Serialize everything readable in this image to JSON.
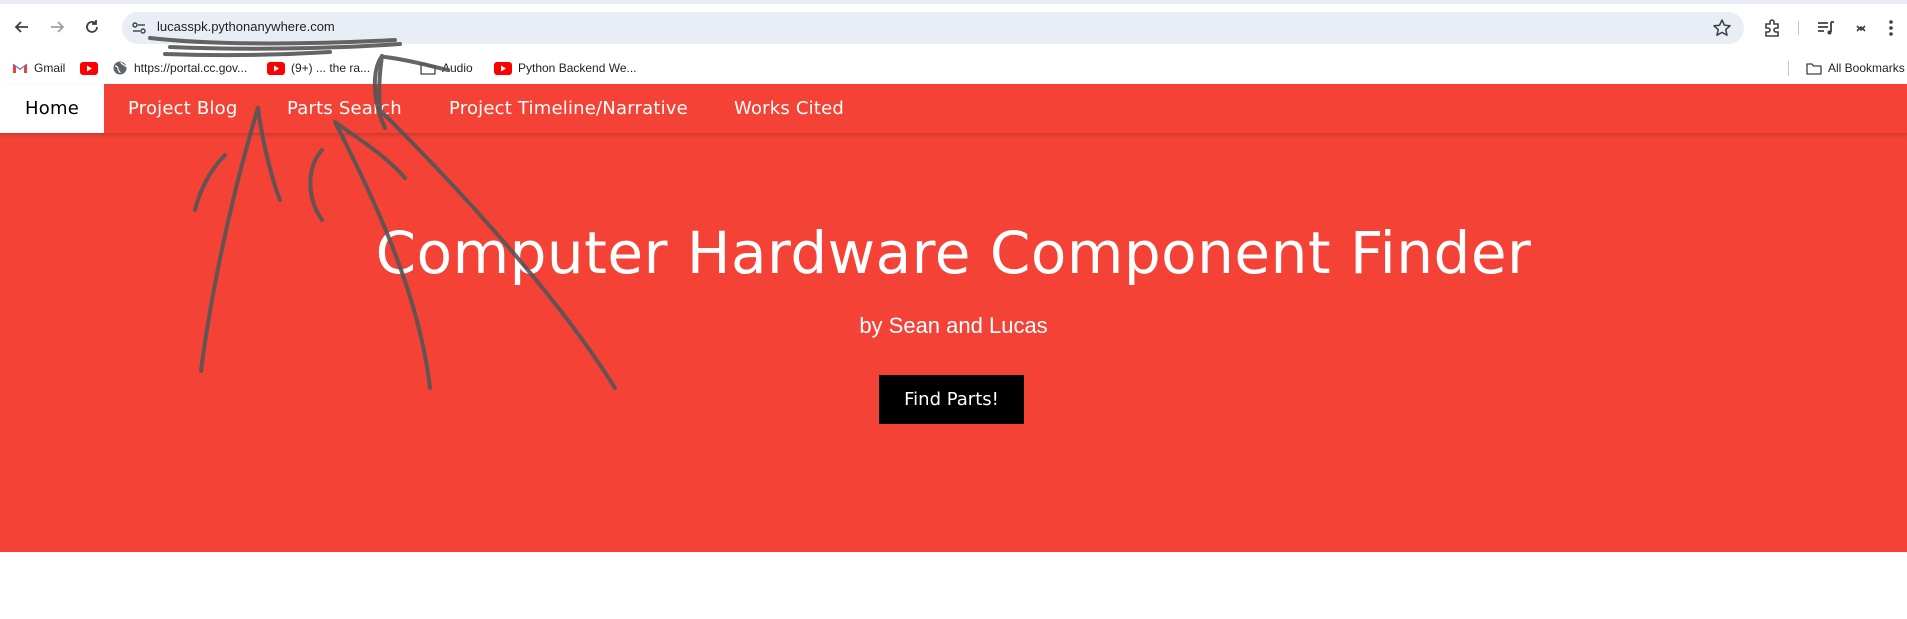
{
  "browser": {
    "url": "lucasspk.pythonanywhere.com",
    "nav": {
      "back_icon": "arrow-left-icon",
      "forward_icon": "arrow-right-icon",
      "reload_icon": "reload-icon"
    },
    "toolbar_icons": [
      "star-icon",
      "extensions-icon",
      "reading-list-icon",
      "account-icon",
      "more-vert-icon"
    ]
  },
  "bookmarks": {
    "items": [
      {
        "label": "Gmail",
        "icon": "gmail-icon"
      },
      {
        "label": "",
        "icon": "youtube-icon"
      },
      {
        "label": "https://portal.cc.gov...",
        "icon": "globe-icon"
      },
      {
        "label": "(9+) ... the ra...",
        "icon": "youtube-icon"
      },
      {
        "label": "Audio",
        "icon": "folder-icon"
      },
      {
        "label": "Python Backend We...",
        "icon": "youtube-icon"
      }
    ],
    "all_bookmarks": "All Bookmarks"
  },
  "site": {
    "nav": {
      "items": [
        {
          "label": "Home",
          "active": true
        },
        {
          "label": "Project Blog",
          "active": false
        },
        {
          "label": "Parts Search",
          "active": false
        },
        {
          "label": "Project Timeline/Narrative",
          "active": false
        },
        {
          "label": "Works Cited",
          "active": false
        }
      ]
    },
    "hero": {
      "title": "Computer Hardware Component Finder",
      "subtitle": "by Sean and Lucas",
      "button": "Find Parts!"
    }
  },
  "colors": {
    "brand_red": "#f44336",
    "button_black": "#000000",
    "text_white": "#ffffff",
    "scribble_gray": "#555555"
  }
}
